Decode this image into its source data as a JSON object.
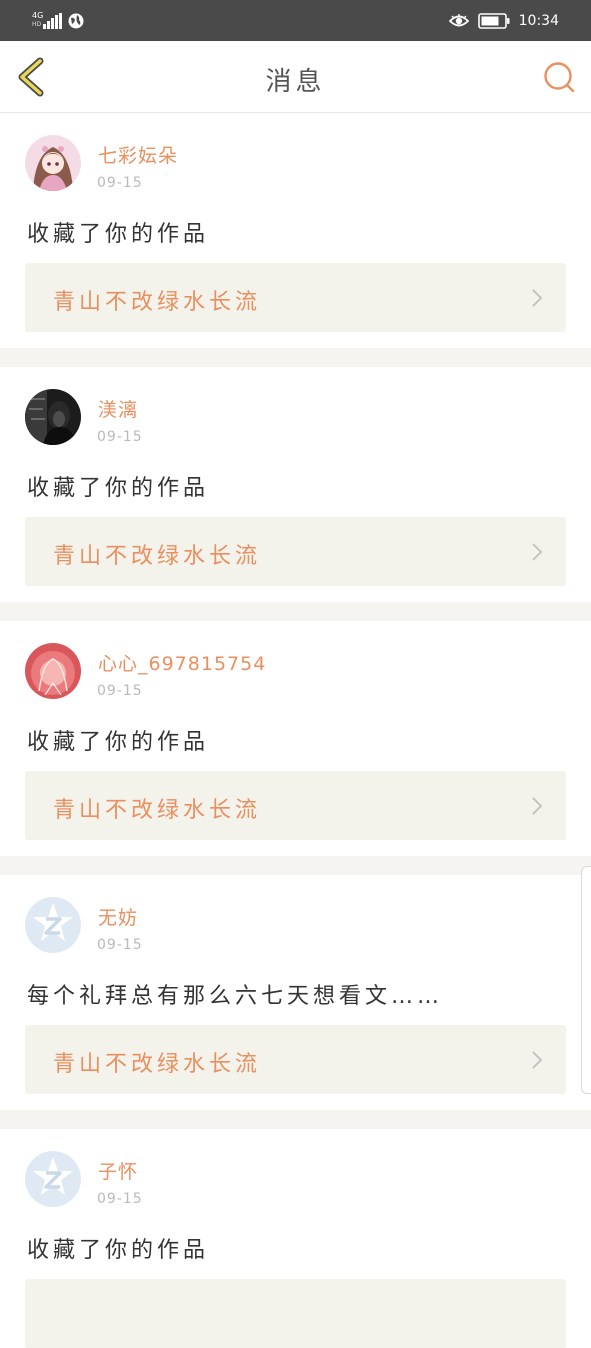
{
  "status_bar": {
    "network_type": "4G",
    "network_sub": "HD",
    "time": "10:34",
    "icons": [
      "signal-icon",
      "globe-icon",
      "eye-icon",
      "battery-icon"
    ]
  },
  "nav": {
    "title": "消息",
    "back_icon": "chevron-left-icon",
    "search_icon": "search-icon"
  },
  "colors": {
    "accent": "#ea8f5f",
    "back_icon": "#e9d75a",
    "work_bg": "#f3f2eb",
    "separator": "#f6f4f1",
    "date": "#b9b9b9"
  },
  "messages": [
    {
      "avatar": "anime-girl-avatar",
      "username": "七彩妘朵",
      "date": "09-15",
      "text": "收藏了你的作品",
      "work_title": "青山不改绿水长流"
    },
    {
      "avatar": "dark-photo-avatar",
      "username": "渼漓",
      "date": "09-15",
      "text": "收藏了你的作品",
      "work_title": "青山不改绿水长流"
    },
    {
      "avatar": "pink-glow-avatar",
      "username": "心心_697815754",
      "date": "09-15",
      "text": "收藏了你的作品",
      "work_title": "青山不改绿水长流"
    },
    {
      "avatar": "default-z-avatar",
      "username": "无妨",
      "date": "09-15",
      "text": "每个礼拜总有那么六七天想看文……",
      "work_title": "青山不改绿水长流"
    },
    {
      "avatar": "default-z-avatar",
      "username": "子怀",
      "date": "09-15",
      "text": "收藏了你的作品",
      "work_title": ""
    }
  ]
}
